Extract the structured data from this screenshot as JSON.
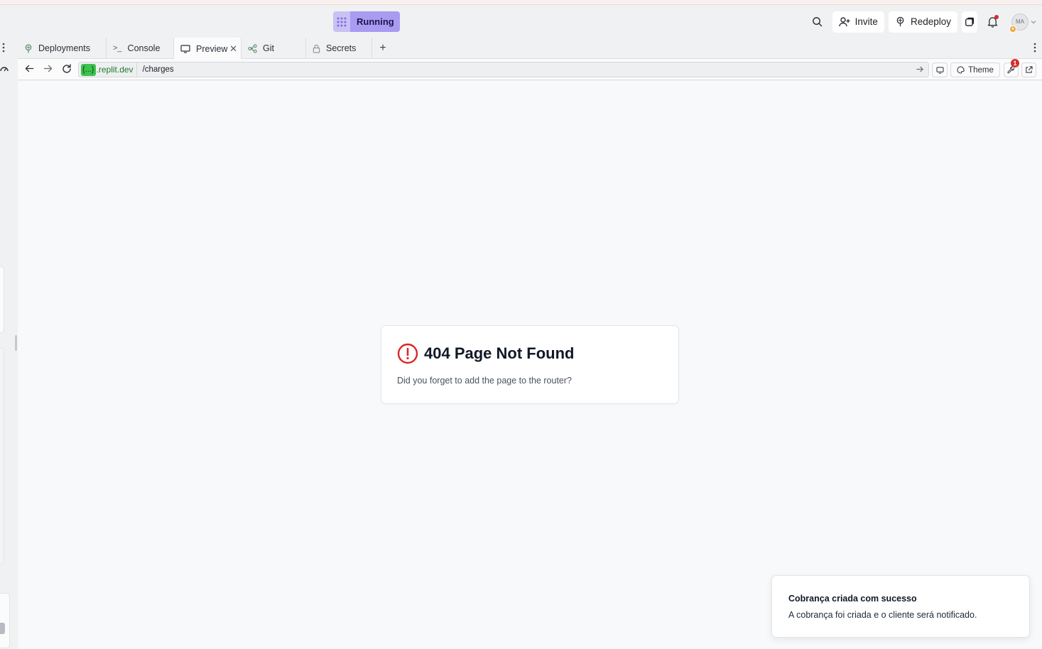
{
  "topbar": {
    "run_label": "Running",
    "invite_label": "Invite",
    "redeploy_label": "Redeploy",
    "avatar_initials": "MA"
  },
  "tabs": [
    {
      "label": "Deployments",
      "icon": "deployments-icon"
    },
    {
      "label": "Console",
      "icon": "console-icon"
    },
    {
      "label": "Preview",
      "icon": "monitor-icon",
      "active": true
    },
    {
      "label": "Git",
      "icon": "git-icon"
    },
    {
      "label": "Secrets",
      "icon": "lock-icon"
    }
  ],
  "urlbar": {
    "host_chip": "{...}",
    "host_domain": ".replit.dev",
    "path": "/charges",
    "theme_label": "Theme",
    "devtools_badge": "1"
  },
  "page": {
    "error_title": "404 Page Not Found",
    "error_message": "Did you forget to add the page to the router?"
  },
  "toast": {
    "title": "Cobrança criada com sucesso",
    "message": "A cobrança foi criada e o cliente será notificado."
  },
  "colors": {
    "run_button": "#a89bf0",
    "error_icon": "#dc2626",
    "host_chip": "#3cc24f"
  }
}
